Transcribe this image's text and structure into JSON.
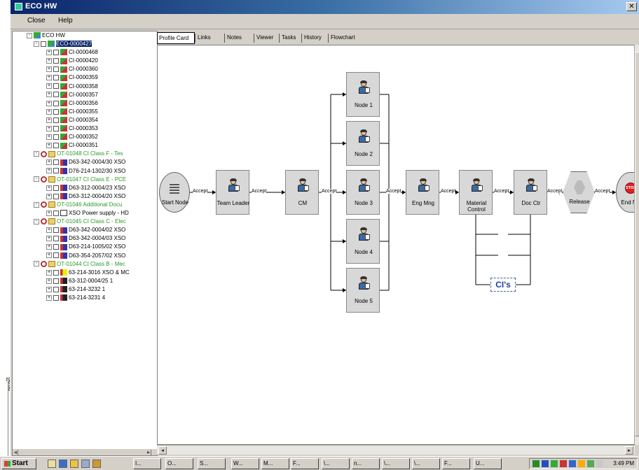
{
  "window": {
    "title": "ECO HW",
    "close_glyph": "✕"
  },
  "menu": {
    "close": "Close",
    "help": "Help"
  },
  "tree": {
    "root": "ECO HW",
    "items": [
      {
        "label": "ECO-0000427",
        "level": 1,
        "icon": "eco",
        "selected": true
      },
      {
        "label": "CI-0000468",
        "level": 2,
        "icon": "ci"
      },
      {
        "label": "CI-0000420",
        "level": 2,
        "icon": "ci"
      },
      {
        "label": "CI-0000360",
        "level": 2,
        "icon": "ci"
      },
      {
        "label": "CI-0000359",
        "level": 2,
        "icon": "ci"
      },
      {
        "label": "CI-0000358",
        "level": 2,
        "icon": "ci"
      },
      {
        "label": "CI-0000357",
        "level": 2,
        "icon": "ci"
      },
      {
        "label": "CI-0000356",
        "level": 2,
        "icon": "ci"
      },
      {
        "label": "CI-0000355",
        "level": 2,
        "icon": "ci"
      },
      {
        "label": "CI-0000354",
        "level": 2,
        "icon": "ci"
      },
      {
        "label": "CI-0000353",
        "level": 2,
        "icon": "ci"
      },
      {
        "label": "CI-0000352",
        "level": 2,
        "icon": "ci"
      },
      {
        "label": "CI-0000351",
        "level": 2,
        "icon": "ci"
      },
      {
        "label": "OT-01048 CI Class F - Tes",
        "level": 1,
        "icon": "folder",
        "green": true
      },
      {
        "label": "D63-342-0004/30 XSO",
        "level": 2,
        "icon": "part"
      },
      {
        "label": "D76-214-1302/30 XSO",
        "level": 2,
        "icon": "part"
      },
      {
        "label": "OT-01047 CI Class E - PCE",
        "level": 1,
        "icon": "folder",
        "green": true
      },
      {
        "label": "D63-312-0004/23 XSO",
        "level": 2,
        "icon": "part"
      },
      {
        "label": "D63-312-0004/20 XSO",
        "level": 2,
        "icon": "part"
      },
      {
        "label": "OT-01046 Additional Docu",
        "level": 1,
        "icon": "folder",
        "green": true
      },
      {
        "label": "XSO Power supply - HD",
        "level": 2,
        "icon": "doc"
      },
      {
        "label": "OT-01045 CI Class C - Elec",
        "level": 1,
        "icon": "folder",
        "green": true
      },
      {
        "label": "D63-342-0004/02 XSO",
        "level": 2,
        "icon": "part"
      },
      {
        "label": "D63-342-0004/03 XSO",
        "level": 2,
        "icon": "part"
      },
      {
        "label": "D63-214-1005/02 XSO",
        "level": 2,
        "icon": "part"
      },
      {
        "label": "D63-354-2057/02 XSO",
        "level": 2,
        "icon": "part"
      },
      {
        "label": "OT-01044 CI Class B - Mec",
        "level": 1,
        "icon": "folder",
        "green": true
      },
      {
        "label": "63-214-3016 XSO & MC",
        "level": 2,
        "icon": "hl"
      },
      {
        "label": "63-312-0004/25 1",
        "level": 2,
        "icon": "tb"
      },
      {
        "label": "63-214-3232 1",
        "level": 2,
        "icon": "tb"
      },
      {
        "label": "63-214-3231 4",
        "level": 2,
        "icon": "tb"
      }
    ]
  },
  "tabs": [
    "Profile Card",
    "Links",
    "Notes",
    "Viewer",
    "Tasks",
    "History",
    "Flowchart"
  ],
  "flowchart": {
    "start": "Start Node",
    "nodes": [
      "Team Leader",
      "CM",
      "Node 1",
      "Node 2",
      "Node 3",
      "Node 4",
      "Node 5",
      "Eng Mng",
      "Material Control",
      "Doc Ctr"
    ],
    "release": "Release",
    "end": "End Nod",
    "edge_label": "Accept",
    "cis_label": "CI's"
  },
  "taskbar": {
    "start": "Start",
    "buttons": [
      "I...",
      "O...",
      "S...",
      "W...",
      "M...",
      "F...",
      "\\...",
      "n...",
      "\\...",
      "\\...",
      "F...",
      "U..."
    ],
    "clock": "3:49 PM"
  }
}
